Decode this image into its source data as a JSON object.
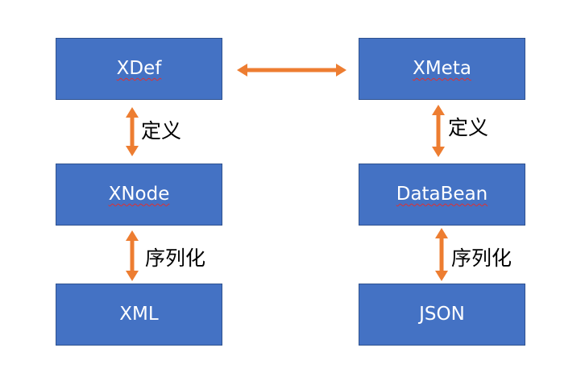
{
  "nodes": {
    "xdef": "XDef",
    "xmeta": "XMeta",
    "xnode": "XNode",
    "databean": "DataBean",
    "xml": "XML",
    "json": "JSON"
  },
  "edges": {
    "left_define": "定义",
    "right_define": "定义",
    "left_serialize": "序列化",
    "right_serialize": "序列化"
  },
  "colors": {
    "box_fill": "#4472c4",
    "box_border": "#2f528f",
    "arrow": "#ed7d31",
    "text_on_box": "#ffffff",
    "edge_text": "#000000"
  }
}
